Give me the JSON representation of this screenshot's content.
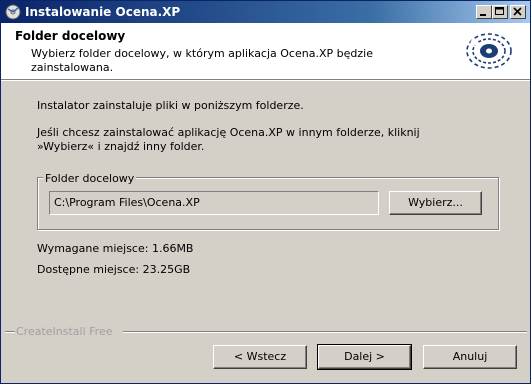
{
  "window": {
    "title": "Instalowanie Ocena.XP"
  },
  "header": {
    "title": "Folder docelowy",
    "subtitle": "Wybierz folder docelowy, w którym aplikacja Ocena.XP będzie zainstalowana."
  },
  "body": {
    "info1": "Instalator zainstaluje pliki w poniższym folderze.",
    "info2_line1": "Jeśli chcesz zainstalować aplikację Ocena.XP w innym folderze, kliknij",
    "info2_line2": "»Wybierz« i znajdź inny folder.",
    "group_label": "Folder docelowy",
    "path_value": "C:\\Program Files\\Ocena.XP",
    "browse_label": "Wybierz...",
    "required_space": "Wymagane miejsce: 1.66MB",
    "available_space": "Dostępne miejsce: 23.25GB"
  },
  "footer": {
    "brand": "CreateInstall Free",
    "back_label": "< Wstecz",
    "next_label": "Dalej >",
    "cancel_label": "Anuluj"
  },
  "icons": {
    "app": "installer-icon",
    "logo": "cd-disc-icon",
    "minimize": "minimize-icon",
    "maximize": "maximize-icon",
    "close": "close-icon"
  },
  "colors": {
    "titlebar_start": "#0a246a",
    "titlebar_end": "#a6caf0",
    "face": "#d4d0c8"
  }
}
